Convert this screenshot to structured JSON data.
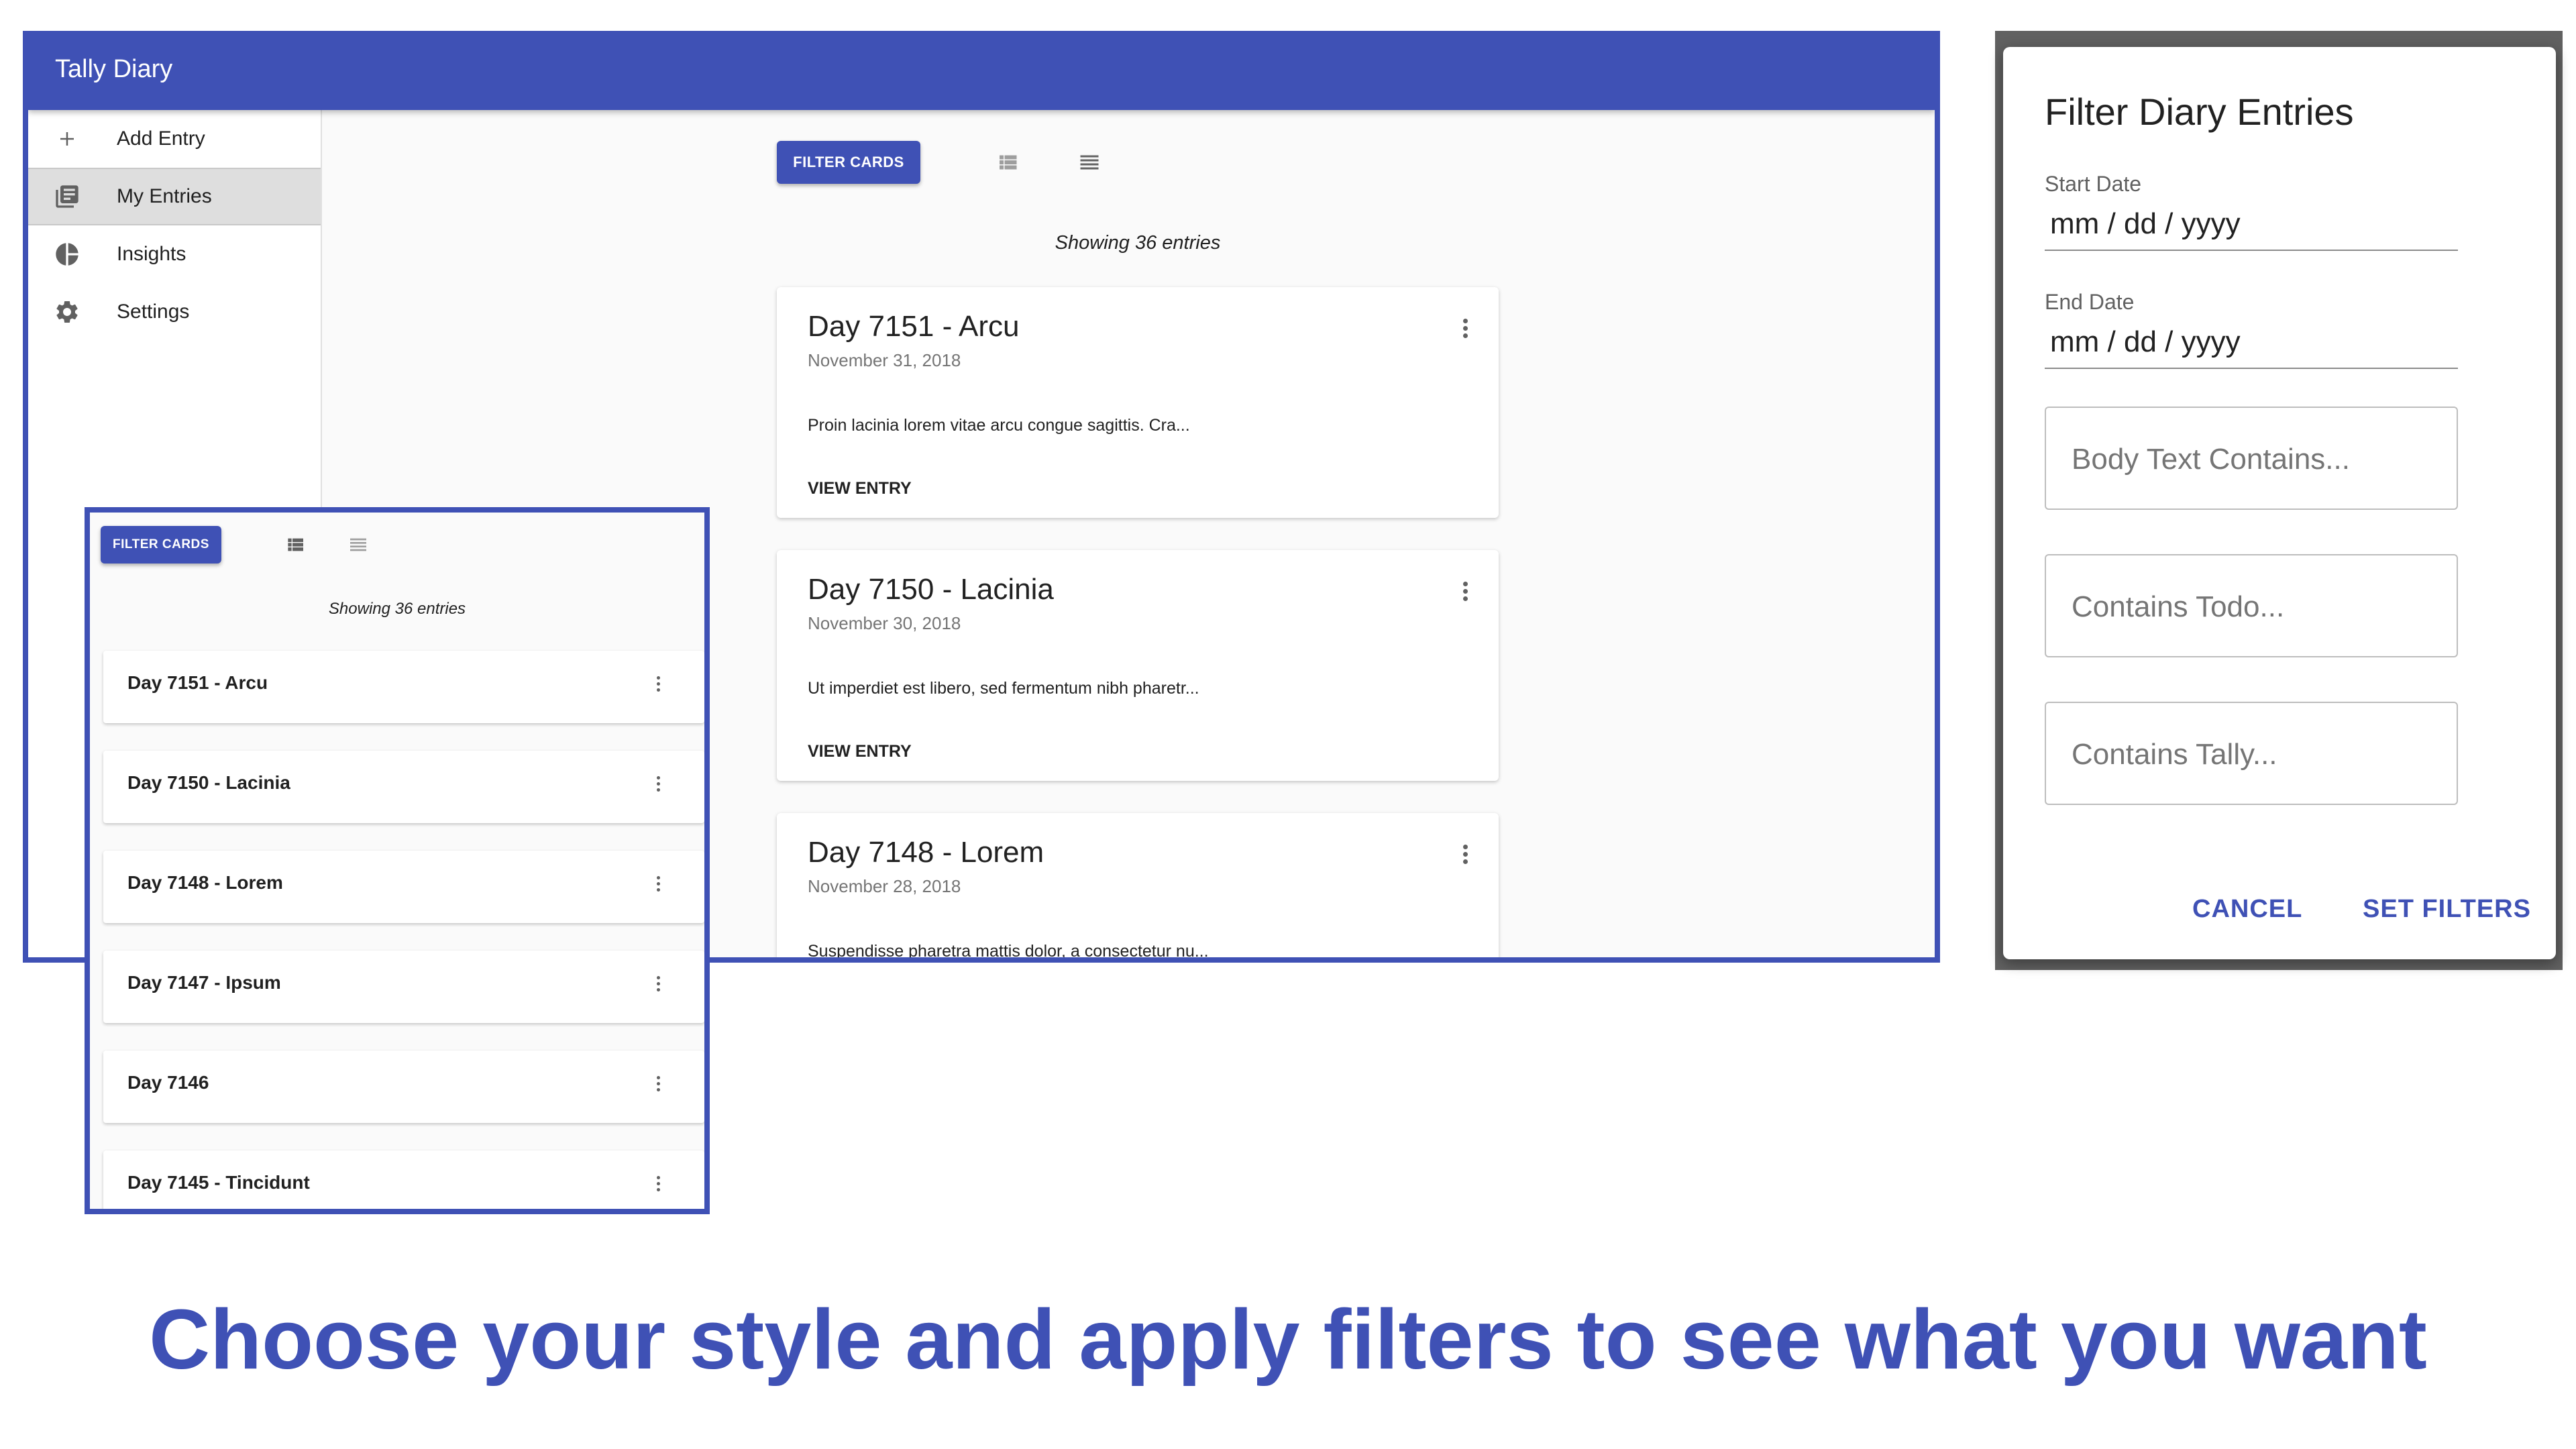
{
  "app": {
    "title": "Tally Diary"
  },
  "nav": [
    {
      "label": "Add Entry",
      "icon": "plus-icon"
    },
    {
      "label": "My Entries",
      "icon": "entries-icon",
      "active": true
    },
    {
      "label": "Insights",
      "icon": "pie-chart-icon"
    },
    {
      "label": "Settings",
      "icon": "gear-icon"
    }
  ],
  "toolbar": {
    "filter_label": "FILTER CARDS",
    "card_view_icon": "card-view-icon",
    "list_view_icon": "list-view-icon"
  },
  "entries_summary": "Showing 36 entries",
  "cards": [
    {
      "title": "Day 7151 - Arcu",
      "date": "November 31, 2018",
      "body": "Proin lacinia lorem vitae arcu congue sagittis. Cra...",
      "action": "VIEW ENTRY"
    },
    {
      "title": "Day 7150 - Lacinia",
      "date": "November 30, 2018",
      "body": "Ut imperdiet est libero, sed fermentum nibh pharetr...",
      "action": "VIEW ENTRY"
    },
    {
      "title": "Day 7148 - Lorem",
      "date": "November 28, 2018",
      "body": "Suspendisse pharetra mattis dolor, a consectetur nu..."
    }
  ],
  "compact": {
    "filter_label": "FILTER CARDS",
    "summary": "Showing 36 entries",
    "items": [
      {
        "title": "Day 7151 - Arcu"
      },
      {
        "title": "Day 7150 - Lacinia"
      },
      {
        "title": "Day 7148 - Lorem"
      },
      {
        "title": "Day 7147 - Ipsum"
      },
      {
        "title": "Day 7146"
      },
      {
        "title": "Day 7145 - Tincidunt"
      }
    ]
  },
  "dialog": {
    "title": "Filter Diary Entries",
    "start_label": "Start Date",
    "start_value": "mm / dd / yyyy",
    "end_label": "End Date",
    "end_value": "mm / dd / yyyy",
    "body_placeholder": "Body Text Contains...",
    "todo_placeholder": "Contains Todo...",
    "tally_placeholder": "Contains Tally...",
    "cancel": "CANCEL",
    "submit": "SET FILTERS"
  },
  "caption": "Choose your style and apply filters to see what you want",
  "colors": {
    "primary": "#3f51b5",
    "background": "#fafafa",
    "drawer_active": "#dedede"
  }
}
